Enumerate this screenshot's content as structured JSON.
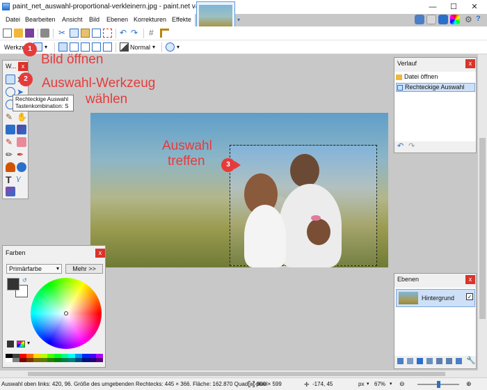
{
  "window": {
    "title": "paint_net_auswahl-proportional-verkleinern.jpg - paint.net v4.2.12",
    "min": "—",
    "max": "☐",
    "close": "✕"
  },
  "menu": [
    "Datei",
    "Bearbeiten",
    "Ansicht",
    "Bild",
    "Ebenen",
    "Korrekturen",
    "Effekte"
  ],
  "toolbar2": {
    "tool_label": "Werkzeug:",
    "blend_mode": "Normal"
  },
  "annotations": {
    "step1": "Bild öffnen",
    "step2_line1": "Auswahl-Werkzeug",
    "step2_line2": "wählen",
    "step3_line1": "Auswahl",
    "step3_line2": "treffen",
    "badge1": "1",
    "badge2": "2",
    "badge3": "3"
  },
  "tools_panel": {
    "title": "W...",
    "close": "x"
  },
  "tooltip": {
    "line1": "Rechteckige Auswahl",
    "line2": "Tastenkombination: S"
  },
  "history_panel": {
    "title": "Verlauf",
    "close": "x",
    "items": [
      "Datei öffnen",
      "Rechteckige Auswahl"
    ]
  },
  "layers_panel": {
    "title": "Ebenen",
    "close": "x",
    "layer_name": "Hintergrund"
  },
  "colors_panel": {
    "title": "Farben",
    "close": "x",
    "select": "Primärfarbe",
    "more": "Mehr >>"
  },
  "statusbar": {
    "text": "Auswahl oben links: 420, 96. Größe des umgebenden Rechtecks: 445 × 366. Fläche: 162.870 Quadrat-pixel",
    "size": "900 × 599",
    "cursor": "-174, 45",
    "unit": "px",
    "zoom": "67%"
  },
  "colors": {
    "accent": "#e63b3b",
    "panelClose": "#d9342b"
  }
}
